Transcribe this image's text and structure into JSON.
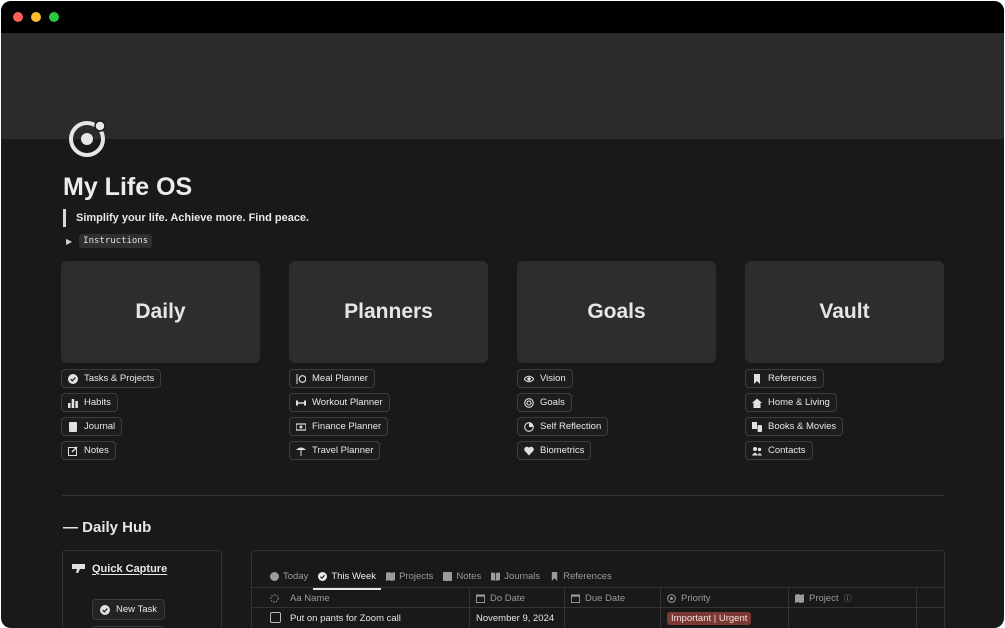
{
  "page": {
    "title": "My Life OS",
    "quote": "Simplify your life. Achieve more. Find peace.",
    "toggle_label": "Instructions"
  },
  "cards": [
    {
      "title": "Daily",
      "links": [
        {
          "label": "Tasks & Projects",
          "icon": "check-circle-icon"
        },
        {
          "label": "Habits",
          "icon": "bar-chart-icon"
        },
        {
          "label": "Journal",
          "icon": "book-icon"
        },
        {
          "label": "Notes",
          "icon": "edit-icon"
        }
      ]
    },
    {
      "title": "Planners",
      "links": [
        {
          "label": "Meal Planner",
          "icon": "utensils-icon"
        },
        {
          "label": "Workout Planner",
          "icon": "dumbbell-icon"
        },
        {
          "label": "Finance Planner",
          "icon": "money-icon"
        },
        {
          "label": "Travel Planner",
          "icon": "umbrella-icon"
        }
      ]
    },
    {
      "title": "Goals",
      "links": [
        {
          "label": "Vision",
          "icon": "eye-icon"
        },
        {
          "label": "Goals",
          "icon": "target-icon"
        },
        {
          "label": "Self Reflection",
          "icon": "pie-icon"
        },
        {
          "label": "Biometrics",
          "icon": "heart-pulse-icon"
        }
      ]
    },
    {
      "title": "Vault",
      "links": [
        {
          "label": "References",
          "icon": "bookmark-icon"
        },
        {
          "label": "Home & Living",
          "icon": "home-icon"
        },
        {
          "label": "Books & Movies",
          "icon": "media-icon"
        },
        {
          "label": "Contacts",
          "icon": "people-icon"
        }
      ]
    }
  ],
  "hub": {
    "title": "— Daily Hub",
    "quick_capture": {
      "title": "Quick Capture",
      "button": "New Task"
    },
    "tabs": [
      {
        "label": "Today",
        "active": false
      },
      {
        "label": "This Week",
        "active": true
      },
      {
        "label": "Projects",
        "active": false
      },
      {
        "label": "Notes",
        "active": false
      },
      {
        "label": "Journals",
        "active": false
      },
      {
        "label": "References",
        "active": false
      }
    ],
    "columns": [
      "Aa Name",
      "Do Date",
      "Due Date",
      "Priority",
      "Project"
    ],
    "rows": [
      {
        "name": "Put on pants for Zoom call",
        "do_date": "November 9, 2024",
        "due_date": "",
        "priority": "Important | Urgent",
        "project": ""
      }
    ]
  },
  "colors": {
    "background": "#191919",
    "card": "#2d2d2d",
    "priority_badge": "#7a3a33"
  }
}
